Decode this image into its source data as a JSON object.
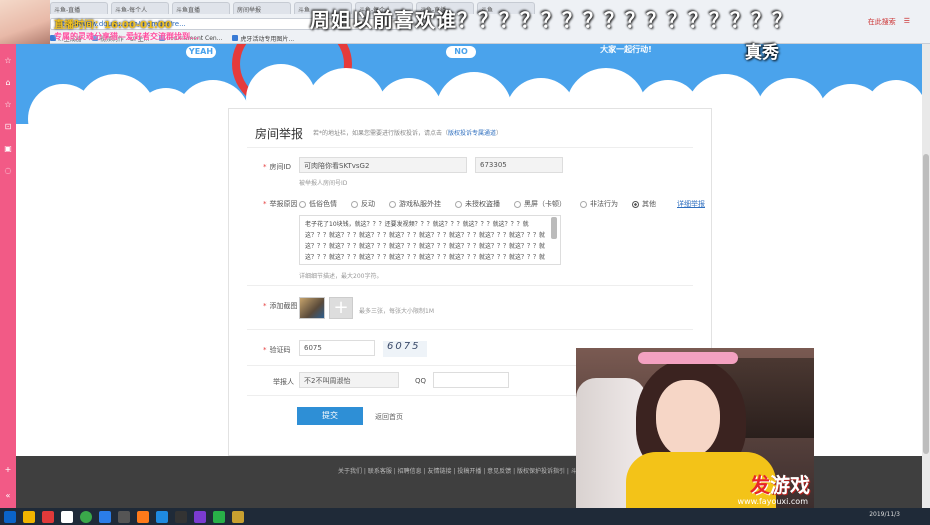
{
  "browser": {
    "tabs": [
      "斗鱼-直播",
      "斗鱼-每个人",
      "斗鱼直播",
      "房间举报",
      "斗鱼",
      "斗鱼-每个人",
      "斗鱼-直播",
      "斗鱼"
    ],
    "url": "https://www.douyu.com/member/re...",
    "right_controls": [
      "在此搜索",
      "☰"
    ],
    "bookmarks": [
      "...生成器",
      "视频制作 - UP主...",
      "Tournament Cen...",
      "虎牙活动专用图片..."
    ]
  },
  "overlay": {
    "time_label": "直播时间：16:00-01:00",
    "notice": "专属的灵魂分享猎—爱好者交流群找到...",
    "danmu_1": "周姐以前喜欢谁？？？？？？？？？？？？？？？？",
    "danmu_2": "真秀"
  },
  "bg": {
    "bubble_left": "YEAH",
    "bubble_mid": "NO",
    "bubble_right": "大家一起行动!"
  },
  "form": {
    "title": "房间举报",
    "hint_prefix": "若*的地址栏，如果您需要进行版权投诉，请点击（",
    "hint_link": "版权投诉专属通道",
    "hint_suffix": "）",
    "room_label": "房间ID",
    "room_name": "可肉陪你看SKTvsG2",
    "room_id": "673305",
    "room_note": "被举报人房间号ID",
    "reason_label": "举报原因",
    "reasons": [
      {
        "label": "低俗色情",
        "checked": false
      },
      {
        "label": "反动",
        "checked": false
      },
      {
        "label": "游戏私服外挂",
        "checked": false
      },
      {
        "label": "未授权盗播",
        "checked": false
      },
      {
        "label": "黑屏（卡顿）",
        "checked": false
      },
      {
        "label": "非法行为",
        "checked": false
      },
      {
        "label": "其他",
        "checked": true
      }
    ],
    "detail_link": "详细举报",
    "reason_text": "老子花了10块钱，就这？？？还要发视频？？？就这？？？就这？？？就这？？？就这？？？就这？？？就这？？？就这？？？就这？？？就这？？？就这？？？就这？？？就这？？？就这？？？就这？？？就这？？？就这？？？就这？？？就这？？？就这？？？就这？？？就这？？？就这？？？就这？？？就这？？？就这？？？就这？？？就这？？？就这？？？就这？？？就这？？？就",
    "reason_note": "详细细节描述，最大200字符。",
    "screenshot_label": "添加截图",
    "screenshot_note": "最多三张，每张大小限制1M",
    "captcha_label": "验证码",
    "captcha_value": "6075",
    "captcha_image_text": "6075",
    "reporter_label": "举报人",
    "reporter_value": "不2不叫周淑怡",
    "qq_label": "QQ",
    "qq_value": "",
    "submit": "提交",
    "back": "返回首页"
  },
  "footer": {
    "links": "关于我们 | 联系客服 | 招聘信息 | 友情链接 | 投稿开播 | 意见反馈 | 版权保护投诉指引 | 斗鱼..."
  },
  "webcam": {
    "logo_fa": "发",
    "logo_rest": "游戏",
    "url": "www.fayouxi.com"
  },
  "taskbar": {
    "clock": "2019/11/3"
  },
  "colors": {
    "sidebar": "#f25a86",
    "page_bg": "#4aa3ec",
    "submit": "#2e8fd6",
    "link": "#2f6fbf"
  }
}
